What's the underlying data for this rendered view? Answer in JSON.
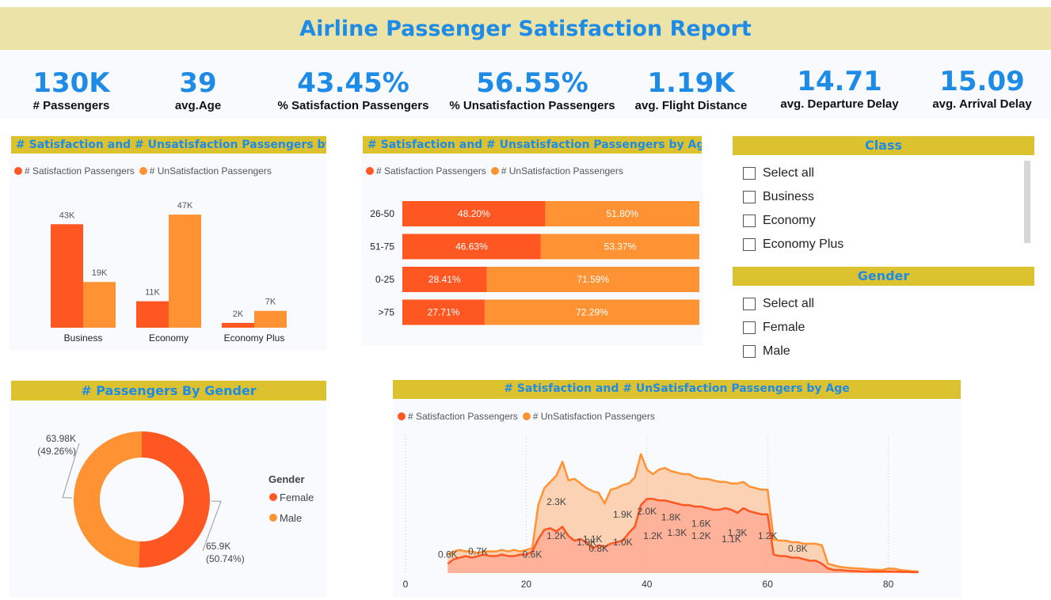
{
  "report_title": "Airline Passenger Satisfaction Report",
  "colors": {
    "accent_blue": "#1e8ce6",
    "header_gold": "#ddc22f",
    "title_bg": "#ece3a8",
    "satisfied": "#ff5722",
    "unsatisfied": "#ff9232"
  },
  "kpis": [
    {
      "value": "130K",
      "label": "# Passengers"
    },
    {
      "value": "39",
      "label": "avg.Age"
    },
    {
      "value": "43.45%",
      "label": "% Satisfaction Passengers"
    },
    {
      "value": "56.55%",
      "label": "% Unsatisfaction Passengers"
    },
    {
      "value": "1.19K",
      "label": "avg. Flight Distance"
    },
    {
      "value": "14.71",
      "label": "avg. Departure Delay"
    },
    {
      "value": "15.09",
      "label": "avg. Arrival Delay"
    }
  ],
  "legend": {
    "satisfied": "# Satisfaction Passengers",
    "unsatisfied_class": "# UnSatisfaction Passengers",
    "unsatisfied_age": "# UnSatisfaction Passengers"
  },
  "slicers": {
    "class": {
      "title": "Class",
      "items": [
        "Select all",
        "Business",
        "Economy",
        "Economy Plus"
      ]
    },
    "gender": {
      "title": "Gender",
      "items": [
        "Select all",
        "Female",
        "Male"
      ]
    }
  },
  "chart_data": [
    {
      "type": "bar",
      "title": "# Satisfaction and # Unsatisfaction Passengers by Class",
      "categories": [
        "Business",
        "Economy",
        "Economy Plus"
      ],
      "series": [
        {
          "name": "# Satisfaction Passengers",
          "values": [
            43,
            11,
            2
          ],
          "labels": [
            "43K",
            "11K",
            "2K"
          ]
        },
        {
          "name": "# UnSatisfaction Passengers",
          "values": [
            19,
            47,
            7
          ],
          "labels": [
            "19K",
            "47K",
            "7K"
          ]
        }
      ],
      "ylim": [
        0,
        50
      ]
    },
    {
      "type": "bar",
      "orientation": "horizontal-stacked-100",
      "title": "# Satisfaction and # Unsatisfaction Passengers by Age Group",
      "categories": [
        "26-50",
        "51-75",
        "0-25",
        ">75"
      ],
      "series": [
        {
          "name": "# Satisfaction Passengers",
          "values": [
            48.2,
            46.63,
            28.41,
            27.71
          ],
          "labels": [
            "48.20%",
            "46.63%",
            "28.41%",
            "27.71%"
          ]
        },
        {
          "name": "# UnSatisfaction Passengers",
          "values": [
            51.8,
            53.37,
            71.59,
            72.29
          ],
          "labels": [
            "51.80%",
            "53.37%",
            "71.59%",
            "72.29%"
          ]
        }
      ]
    },
    {
      "type": "pie",
      "variant": "donut",
      "title": "# Passengers By Gender",
      "legend_title": "Gender",
      "categories": [
        "Female",
        "Male"
      ],
      "values": [
        65.9,
        63.98
      ],
      "labels": [
        "65.9K",
        "63.98K"
      ],
      "percent_labels": [
        "(50.74%)",
        "(49.26%)"
      ]
    },
    {
      "type": "area",
      "title": "# Satisfaction and # UnSatisfaction Passengers by Age",
      "x_ticks": [
        "0",
        "20",
        "40",
        "60",
        "80"
      ],
      "xlim": [
        0,
        85
      ],
      "ylim": [
        0,
        4.2
      ],
      "series": [
        {
          "name": "# Satisfaction Passengers",
          "x": [
            7,
            8,
            9,
            10,
            11,
            12,
            13,
            14,
            15,
            16,
            17,
            18,
            19,
            20,
            21,
            22,
            23,
            24,
            25,
            26,
            27,
            28,
            29,
            30,
            31,
            32,
            33,
            34,
            35,
            36,
            37,
            38,
            39,
            40,
            41,
            42,
            43,
            44,
            45,
            46,
            47,
            48,
            49,
            50,
            51,
            52,
            53,
            54,
            55,
            56,
            57,
            58,
            59,
            60,
            61,
            62,
            63,
            64,
            65,
            66,
            67,
            68,
            69,
            70,
            71,
            72,
            73,
            74,
            75,
            76,
            77,
            78,
            79,
            80,
            81,
            82,
            83,
            84,
            85
          ],
          "values": [
            0.3,
            0.45,
            0.5,
            0.55,
            0.5,
            0.55,
            0.6,
            0.55,
            0.55,
            0.6,
            0.55,
            0.55,
            0.6,
            0.6,
            0.7,
            1.1,
            1.4,
            1.45,
            1.35,
            1.5,
            1.2,
            1.05,
            1.1,
            1.0,
            0.8,
            0.9,
            0.85,
            0.95,
            1.0,
            1.05,
            1.3,
            1.5,
            2.2,
            2.4,
            2.4,
            2.35,
            2.35,
            2.3,
            2.25,
            2.2,
            2.2,
            2.15,
            2.15,
            2.1,
            2.05,
            2.05,
            2.1,
            2.05,
            1.95,
            2.1,
            2.0,
            1.95,
            1.9,
            1.9,
            0.6,
            0.55,
            0.55,
            0.5,
            0.5,
            0.45,
            0.4,
            0.4,
            0.3,
            0.15,
            0.1,
            0.1,
            0.08,
            0.07,
            0.06,
            0.05,
            0.05,
            0.05,
            0.05,
            0.05,
            0.05,
            0.04,
            0.04,
            0.03,
            0.03
          ],
          "labels": [
            {
              "x": 7,
              "y": 0.6,
              "text": "0.6K"
            },
            {
              "x": 12,
              "y": 0.7,
              "text": "0.7K"
            },
            {
              "x": 21,
              "y": 0.6,
              "text": "0.6K"
            },
            {
              "x": 25,
              "y": 1.2,
              "text": "1.2K"
            },
            {
              "x": 30,
              "y": 1.0,
              "text": "1.0K"
            },
            {
              "x": 32,
              "y": 0.8,
              "text": "0.8K"
            },
            {
              "x": 36,
              "y": 1.0,
              "text": "1.0K"
            },
            {
              "x": 40,
              "y": 2.0,
              "text": "2.0K"
            },
            {
              "x": 44,
              "y": 1.8,
              "text": "1.8K"
            },
            {
              "x": 49,
              "y": 1.6,
              "text": "1.6K"
            },
            {
              "x": 55,
              "y": 1.3,
              "text": "1.3K"
            },
            {
              "x": 60,
              "y": 1.2,
              "text": "1.2K"
            },
            {
              "x": 65,
              "y": 0.8,
              "text": "0.8K"
            }
          ]
        },
        {
          "name": "# UnSatisfaction Passengers",
          "x": [
            7,
            8,
            9,
            10,
            11,
            12,
            13,
            14,
            15,
            16,
            17,
            18,
            19,
            20,
            21,
            22,
            23,
            24,
            25,
            26,
            27,
            28,
            29,
            30,
            31,
            32,
            33,
            34,
            35,
            36,
            37,
            38,
            39,
            40,
            41,
            42,
            43,
            44,
            45,
            46,
            47,
            48,
            49,
            50,
            51,
            52,
            53,
            54,
            55,
            56,
            57,
            58,
            59,
            60,
            61,
            62,
            63,
            64,
            65,
            66,
            67,
            68,
            69,
            70,
            71,
            72,
            73,
            74,
            75,
            76,
            77,
            78,
            79,
            80,
            81,
            82,
            83,
            84,
            85
          ],
          "values": [
            0.6,
            0.7,
            0.75,
            0.7,
            0.7,
            0.65,
            0.7,
            0.7,
            0.7,
            0.75,
            0.7,
            0.75,
            0.7,
            0.75,
            0.8,
            2.2,
            2.75,
            2.95,
            3.15,
            3.6,
            3.0,
            3.05,
            2.9,
            2.75,
            2.65,
            2.6,
            2.25,
            2.7,
            2.75,
            2.85,
            2.9,
            3.1,
            3.85,
            3.35,
            3.2,
            3.35,
            3.4,
            3.3,
            3.25,
            3.2,
            3.2,
            3.1,
            3.05,
            3.05,
            3.0,
            2.95,
            2.95,
            2.9,
            2.9,
            2.95,
            2.8,
            2.75,
            2.7,
            2.7,
            1.1,
            1.05,
            1.05,
            1.0,
            1.0,
            0.95,
            0.95,
            0.95,
            0.9,
            0.3,
            0.25,
            0.2,
            0.18,
            0.16,
            0.15,
            0.14,
            0.12,
            0.11,
            0.1,
            0.15,
            0.14,
            0.1,
            0.08,
            0.06,
            0.05
          ],
          "labels": [
            {
              "x": 25,
              "y": 2.3,
              "text": "2.3K"
            },
            {
              "x": 31,
              "y": 1.1,
              "text": "1.1K"
            },
            {
              "x": 36,
              "y": 1.9,
              "text": "1.9K"
            },
            {
              "x": 41,
              "y": 1.2,
              "text": "1.2K"
            },
            {
              "x": 45,
              "y": 1.3,
              "text": "1.3K"
            },
            {
              "x": 49,
              "y": 1.2,
              "text": "1.2K"
            },
            {
              "x": 54,
              "y": 1.1,
              "text": "1.1K"
            }
          ]
        }
      ]
    }
  ]
}
